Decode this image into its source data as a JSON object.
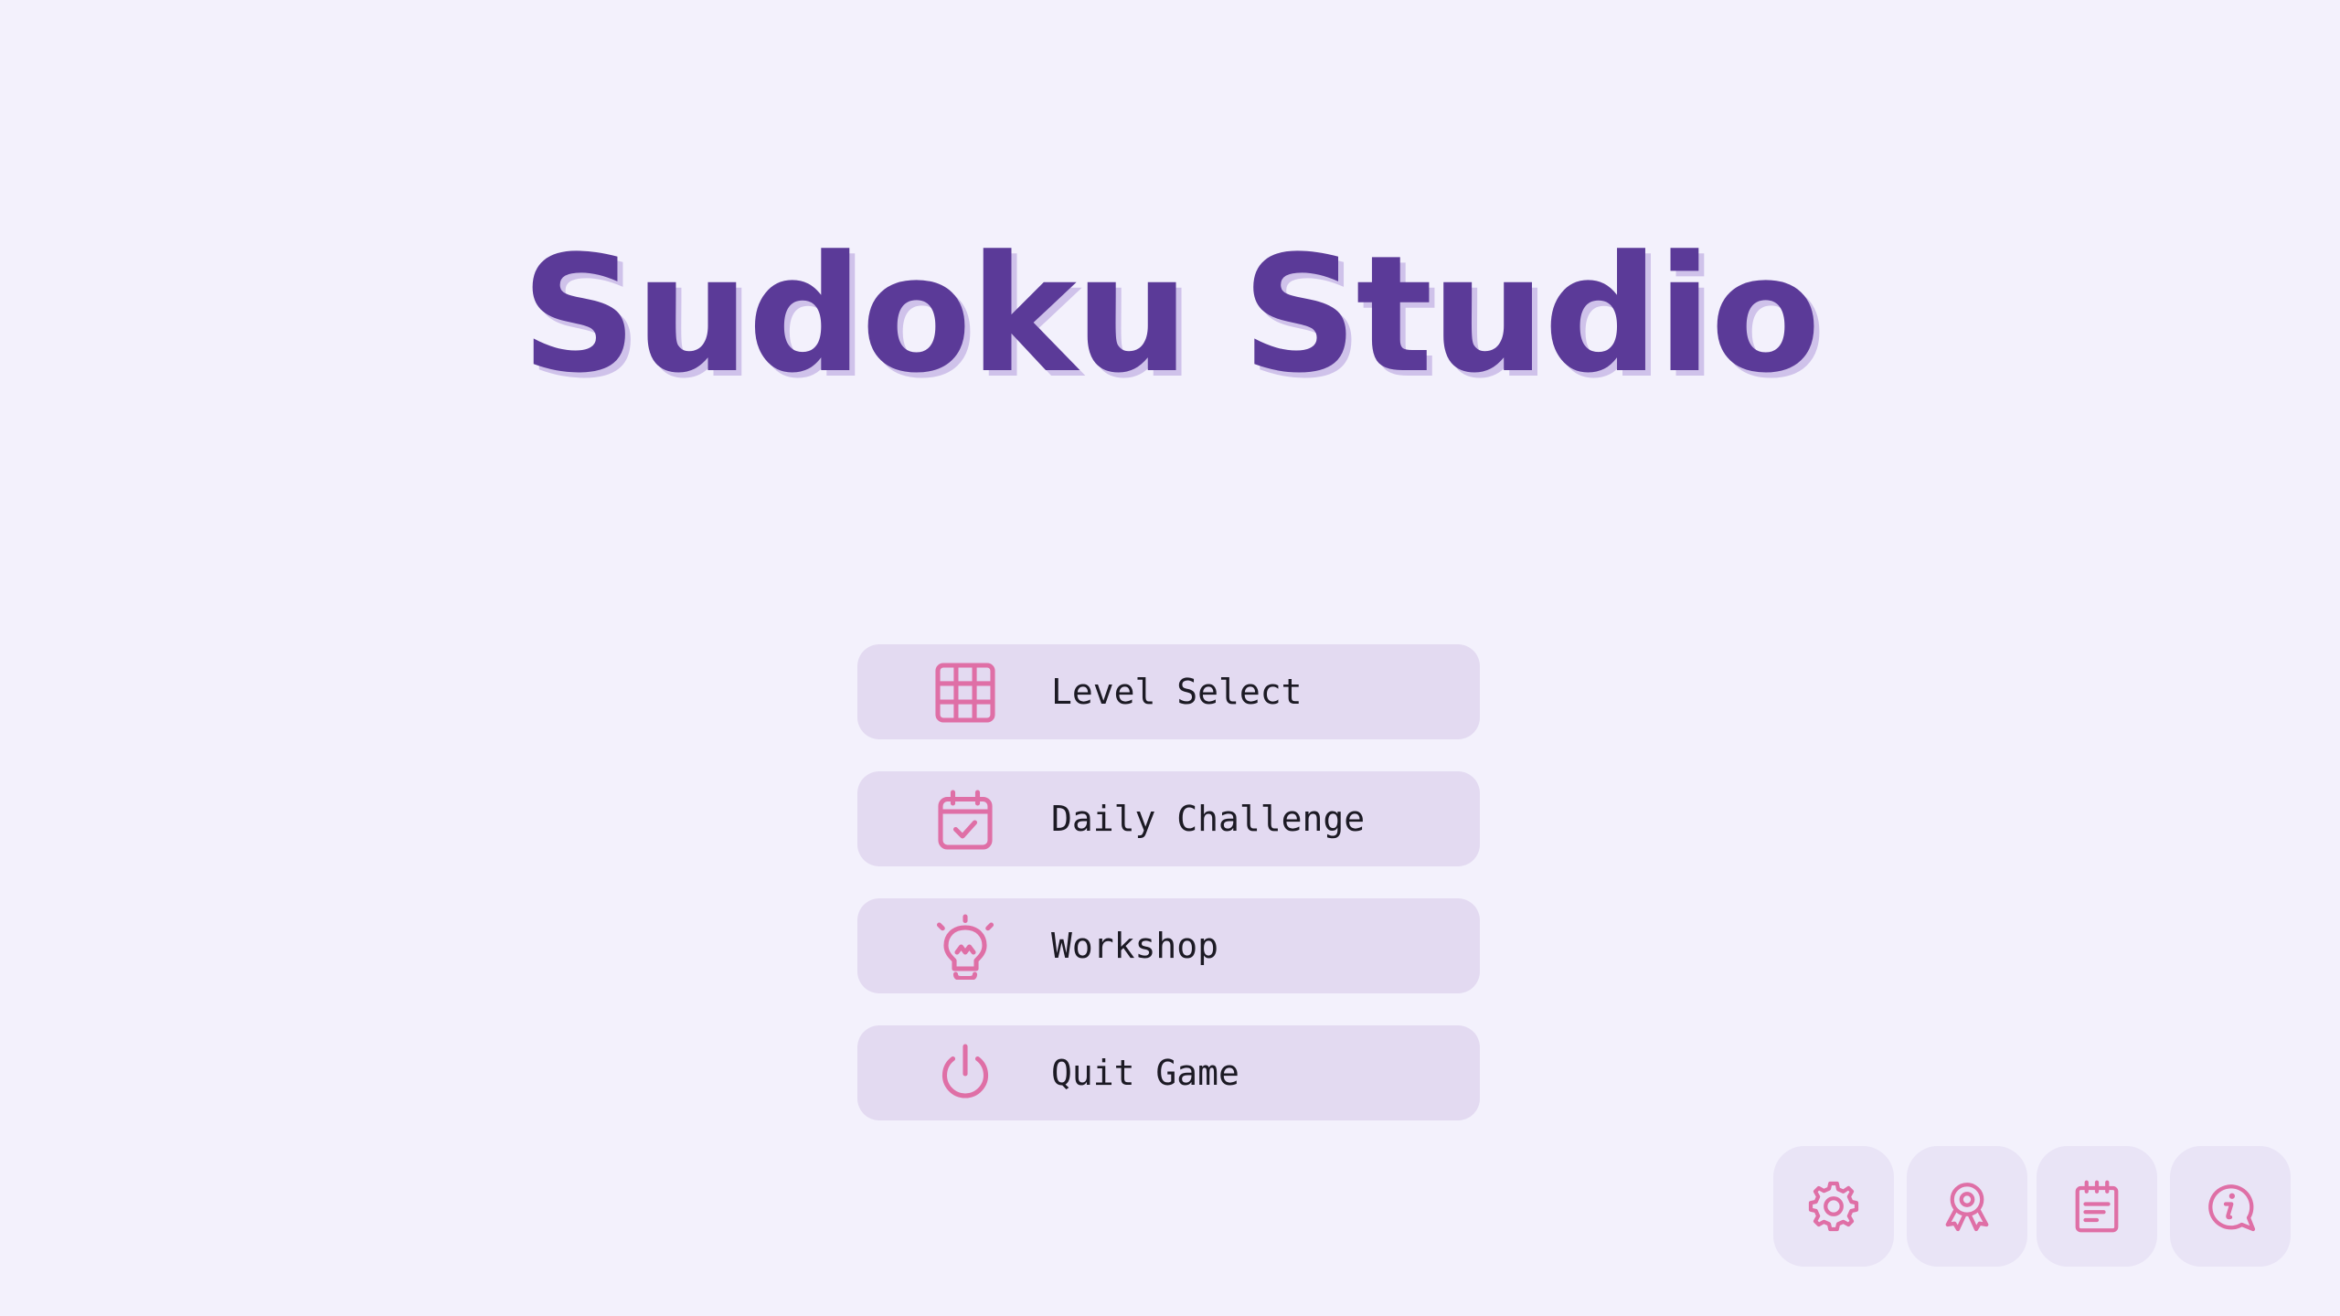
{
  "game": {
    "title": "Sudoku Studio"
  },
  "menu": {
    "items": [
      {
        "label": "Level Select",
        "icon": "grid-icon"
      },
      {
        "label": "Daily Challenge",
        "icon": "calendar-check-icon"
      },
      {
        "label": "Workshop",
        "icon": "lightbulb-icon"
      },
      {
        "label": "Quit Game",
        "icon": "power-icon"
      }
    ]
  },
  "corner_buttons": [
    {
      "icon": "gear-icon",
      "purpose": "settings"
    },
    {
      "icon": "award-ribbon-icon",
      "purpose": "achievements"
    },
    {
      "icon": "notepad-icon",
      "purpose": "notes"
    },
    {
      "icon": "info-chat-icon",
      "purpose": "info"
    }
  ],
  "colors": {
    "background": "#f3f1fc",
    "title": "#5b3a98",
    "title_shadow": "#cfc2ea",
    "button_bg": "#e3daf1",
    "corner_bg": "#e9e4f6",
    "icon": "#df6fa6",
    "label_text": "#1c1a24"
  }
}
